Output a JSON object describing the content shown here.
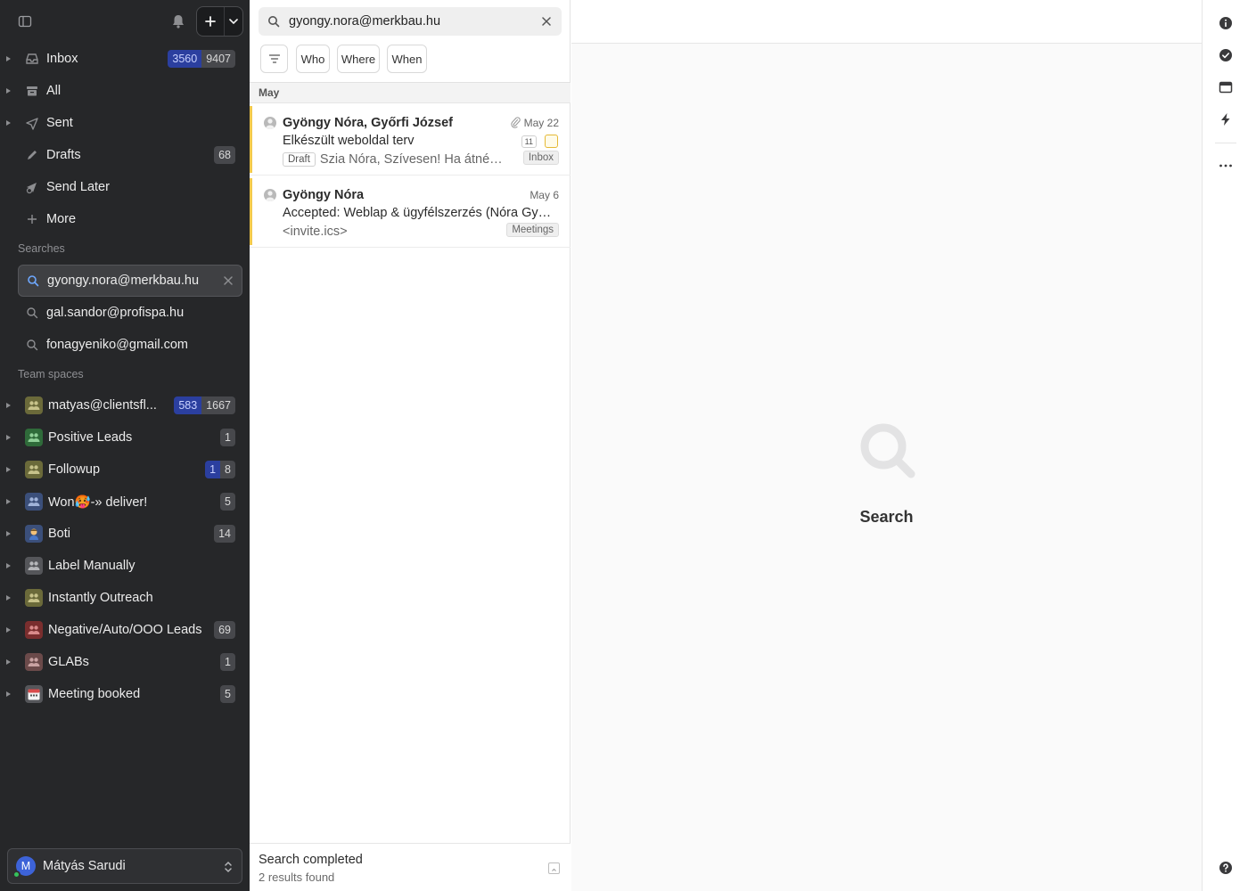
{
  "sidebar": {
    "nav": [
      {
        "label": "Inbox",
        "icon": "inbox-icon",
        "badge_blue": "3560",
        "badge_gray": "9407",
        "arrow": true
      },
      {
        "label": "All",
        "icon": "archive-icon",
        "badge_blue": "",
        "badge_gray": "",
        "arrow": true
      },
      {
        "label": "Sent",
        "icon": "send-icon",
        "badge_blue": "",
        "badge_gray": "",
        "arrow": true
      },
      {
        "label": "Drafts",
        "icon": "pencil-icon",
        "badge_blue": "",
        "badge_gray": "68",
        "arrow": false
      },
      {
        "label": "Send Later",
        "icon": "send-later-icon",
        "badge_blue": "",
        "badge_gray": "",
        "arrow": false
      },
      {
        "label": "More",
        "icon": "plus-icon",
        "badge_blue": "",
        "badge_gray": "",
        "arrow": false
      }
    ],
    "searches_label": "Searches",
    "searches": [
      {
        "label": "gyongy.nora@merkbau.hu",
        "active": true
      },
      {
        "label": "gal.sandor@profispa.hu",
        "active": false
      },
      {
        "label": "fonagyeniko@gmail.com",
        "active": false
      }
    ],
    "team_spaces_label": "Team spaces",
    "team_spaces": [
      {
        "label": "matyas@clientsfl...",
        "badge_blue": "583",
        "badge_gray": "1667",
        "color": "#6b6a3a",
        "icon": "team-icon"
      },
      {
        "label": "Positive Leads",
        "badge_blue": "",
        "badge_gray": "1",
        "color": "#2f6b3a",
        "icon": "team-icon"
      },
      {
        "label": "Followup",
        "badge_blue": "1",
        "badge_gray": "8",
        "color": "#6b6a3a",
        "icon": "team-icon"
      },
      {
        "label": "Won🥵-» deliver!",
        "badge_blue": "",
        "badge_gray": "5",
        "color": "#3b4f7a",
        "icon": "team-icon"
      },
      {
        "label": "Boti",
        "badge_blue": "",
        "badge_gray": "14",
        "color": "#3b4f7a",
        "icon": "person-emoji-icon"
      },
      {
        "label": "Label Manually",
        "badge_blue": "",
        "badge_gray": "",
        "color": "#55565a",
        "icon": "team-icon"
      },
      {
        "label": "Instantly Outreach",
        "badge_blue": "",
        "badge_gray": "",
        "color": "#6b6a3a",
        "icon": "team-icon"
      },
      {
        "label": "Negative/Auto/OOO Leads",
        "badge_blue": "",
        "badge_gray": "69",
        "color": "#7a2e2e",
        "icon": "team-icon"
      },
      {
        "label": "GLABs",
        "badge_blue": "",
        "badge_gray": "1",
        "color": "#6b4a4a",
        "icon": "team-icon"
      },
      {
        "label": "Meeting booked",
        "badge_blue": "",
        "badge_gray": "5",
        "color": "#55565a",
        "icon": "calendar-emoji-icon"
      }
    ],
    "user": {
      "initial": "M",
      "name": "Mátyás Sarudi"
    }
  },
  "list": {
    "search_value": "gyongy.nora@merkbau.hu",
    "filters": [
      "Who",
      "Where",
      "When"
    ],
    "group": "May",
    "messages": [
      {
        "from": "Gyöngy Nóra, Győrfi József",
        "date": "May 22",
        "subject": "Elkészült weboldal terv",
        "count": "11",
        "draft": "Draft",
        "preview": "Szia Nóra, Szívesen! Ha átnézték...",
        "label": "Inbox"
      },
      {
        "from": "Gyöngy Nóra",
        "date": "May 6",
        "subject": "Accepted: Weblap & ügyfélszerzés (Nóra Gyöngy)",
        "count": "",
        "draft": "",
        "preview": "<invite.ics>",
        "label": "Meetings"
      }
    ],
    "status_title": "Search completed",
    "status_sub": "2 results found"
  },
  "reading": {
    "empty_text": "Search"
  },
  "colors": {
    "sidebar_bg": "#262729",
    "accent_blue": "#2b3f9f",
    "unread_bar": "#f2c94c"
  }
}
